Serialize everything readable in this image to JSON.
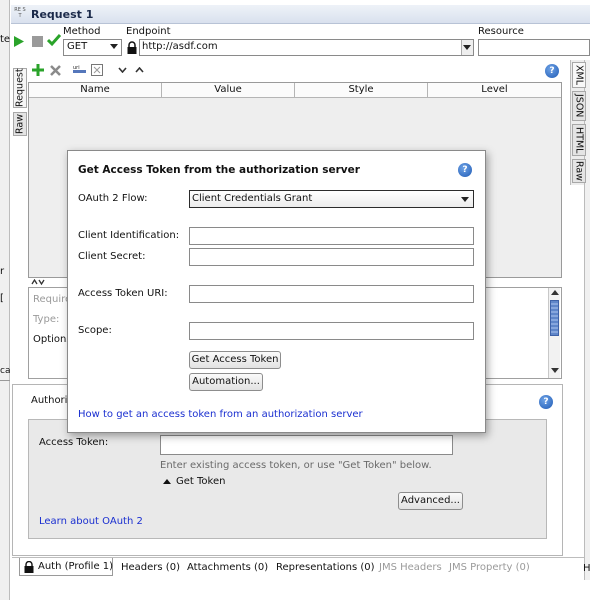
{
  "window": {
    "title": "Request 1",
    "rest_badge": "RE ST"
  },
  "toolbar": {
    "method_label": "Method",
    "method_value": "GET",
    "endpoint_label": "Endpoint",
    "endpoint_value": "http://asdf.com",
    "resource_label": "Resource"
  },
  "left_tabs": [
    "Request",
    "Raw"
  ],
  "params_table": {
    "columns": [
      "Name",
      "Value",
      "Style",
      "Level"
    ]
  },
  "side_tabs": [
    "XML",
    "JSON",
    "HTML",
    "Raw"
  ],
  "details": {
    "required_label": "Require",
    "type_label": "Type:",
    "options_label": "Options"
  },
  "left_edge": [
    "te",
    "r",
    "[",
    "ca"
  ],
  "auth_panel": {
    "title": "Authori",
    "access_token_label": "Access Token:",
    "access_token_value": "",
    "hint": "Enter existing access token, or use \"Get Token\" below.",
    "get_token_label": "Get Token",
    "advanced_button": "Advanced...",
    "learn_link": "Learn about OAuth 2"
  },
  "dialog": {
    "title": "Get Access Token from the authorization server",
    "flow_label": "OAuth 2 Flow:",
    "flow_value": "Client Credentials Grant",
    "client_id_label": "Client Identification:",
    "client_secret_label": "Client Secret:",
    "token_uri_label": "Access Token URI:",
    "scope_label": "Scope:",
    "get_token_button": "Get Access Token",
    "automation_button": "Automation...",
    "help_link": "How to get an access token from an authorization server"
  },
  "bottom_tabs": [
    {
      "label": "Auth (Profile 1)",
      "enabled": true
    },
    {
      "label": "Headers (0)",
      "enabled": true
    },
    {
      "label": "Attachments (0)",
      "enabled": true
    },
    {
      "label": "Representations (0)",
      "enabled": true
    },
    {
      "label": "JMS Headers",
      "enabled": false
    },
    {
      "label": "JMS Property (0)",
      "enabled": false
    }
  ],
  "right_edge_letter": "H",
  "colors": {
    "accent_green": "#2aa32a",
    "link": "#1a2fd0",
    "disabled": "#9a9a9a",
    "title_bar": "#dfe6f2"
  }
}
